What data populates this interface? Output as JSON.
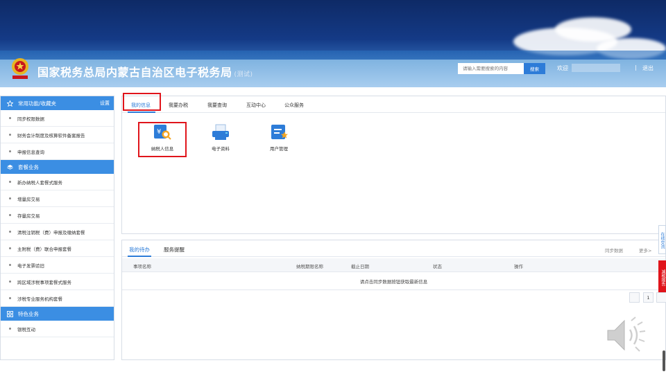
{
  "header": {
    "site_title": "国家税务总局内蒙古自治区电子税务局",
    "site_title_suffix": "(测试)",
    "search_placeholder": "请输入需要搜索的内容",
    "search_button": "搜索",
    "welcome": "欢迎",
    "separator": "|",
    "logout": "退出"
  },
  "sidebar": {
    "sections": [
      {
        "title": "常用功能/收藏夹",
        "action": "设置",
        "icon": "star-icon",
        "items": [
          "同步权限数据",
          "财务会计制度及核算软件备案报告",
          "申报信息查询"
        ]
      },
      {
        "title": "套餐业务",
        "icon": "stack-icon",
        "items": [
          "新办纳税人套餐式服务",
          "增量房交易",
          "存量房交易",
          "清税注销税（费）申报及缴纳套餐",
          "主附税（费）联合申报套餐",
          "电子发票验旧",
          "跨区域涉税事项套餐式服务",
          "涉税专业服务机构套餐"
        ]
      },
      {
        "title": "特色业务",
        "icon": "grid-icon",
        "items": [
          "银税互动"
        ]
      }
    ]
  },
  "tabs": [
    "我的信息",
    "我要办税",
    "我要查询",
    "互动中心",
    "公众服务"
  ],
  "tiles": [
    {
      "label": "纳税人信息",
      "icon": "taxpayer-info-icon"
    },
    {
      "label": "电子资料",
      "icon": "electronic-docs-icon"
    },
    {
      "label": "用户管理",
      "icon": "user-management-icon"
    }
  ],
  "bottom": {
    "tabs": [
      "我的待办",
      "服务提醒"
    ],
    "sync": "同步数据",
    "more": "更多>",
    "columns": [
      "事项名称",
      "纳税期限名称",
      "截止日期",
      "状态",
      "操作"
    ],
    "empty_message": "请点击同步数据按钮获取最新信息",
    "page": "1"
  },
  "floats": {
    "online": "在线交流",
    "report": "减税报告"
  },
  "colors": {
    "accent": "#2d7cd8",
    "sidebar_header": "#3b8ee3",
    "highlight_box": "#e0141b",
    "banner_dark": "#0e2a66"
  }
}
